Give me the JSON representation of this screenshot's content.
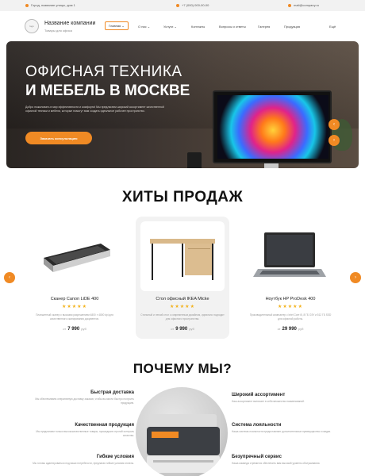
{
  "topbar": {
    "address": "Город, название улицы, дом 1",
    "phone": "+7 (000) 000-00-00",
    "email": "mail@company.ru"
  },
  "header": {
    "logo_text": "logo",
    "company_name": "Название компании",
    "company_sub": "Товары для офиса",
    "nav": [
      "Главная",
      "О нас",
      "Услуги",
      "Контакты",
      "Вопросы и ответы",
      "Галерея",
      "Продукция",
      "Ещё"
    ]
  },
  "hero": {
    "title_line1": "ОФИСНАЯ ТЕХНИКА",
    "title_line2": "И МЕБЕЛЬ В МОСКВЕ",
    "description": "Добро пожаловать в мир эффективности и комфорта! Мы предлагаем широкий ассортимент качественной офисной техники и мебели, которые помогут вам создать идеальное рабочее пространство.",
    "button": "Заказать консультацию"
  },
  "hits": {
    "title": "ХИТЫ ПРОДАЖ",
    "stars": "★★★★★",
    "price_prefix": "от",
    "currency": "руб",
    "products": [
      {
        "name": "Сканер Canon LiDE 400",
        "desc": "Планшетный сканер с высоким разрешением 4800 × 4800 dpi для качественного сканирования документов.",
        "price": "7 990"
      },
      {
        "name": "Стол офисный IKEA Micke",
        "desc": "Стильный и легкий стол с современным дизайном, идеально подходит для офисного пространства.",
        "price": "9 990"
      },
      {
        "name": "Ноутбук HP ProDesk 400",
        "desc": "Производительный компьютер с Intel Core i5, 8 ГБ ОЗУ и 512 ГБ SSD для офисной работы.",
        "price": "29 990"
      }
    ]
  },
  "why": {
    "title": "ПОЧЕМУ МЫ?",
    "left": [
      {
        "title": "Быстрая доставка",
        "text": "Мы обеспечиваем оперативную доставку заказов, чтобы вы могли быстро получить продукцию."
      },
      {
        "title": "Качественная продукция",
        "text": "Мы предлагаем только высококачественные товары, прошедшие строгий контроль качества."
      },
      {
        "title": "Гибкие условия",
        "text": "Мы готовы адаптироваться под ваши потребности, предлагая гибкие условия оплаты."
      }
    ],
    "right": [
      {
        "title": "Широкий ассортимент",
        "text": "Наш ассортимент включает в себя множество наименований."
      },
      {
        "title": "Система лояльности",
        "text": "Наша система лояльности предоставляет дополнительные преимущества и скидки."
      },
      {
        "title": "Безупречный сервис",
        "text": "Наша команда стремится обеспечить вам высокий уровень обслуживания."
      }
    ]
  },
  "colors": {
    "accent": "#f08a24",
    "star": "#f3b21b"
  }
}
